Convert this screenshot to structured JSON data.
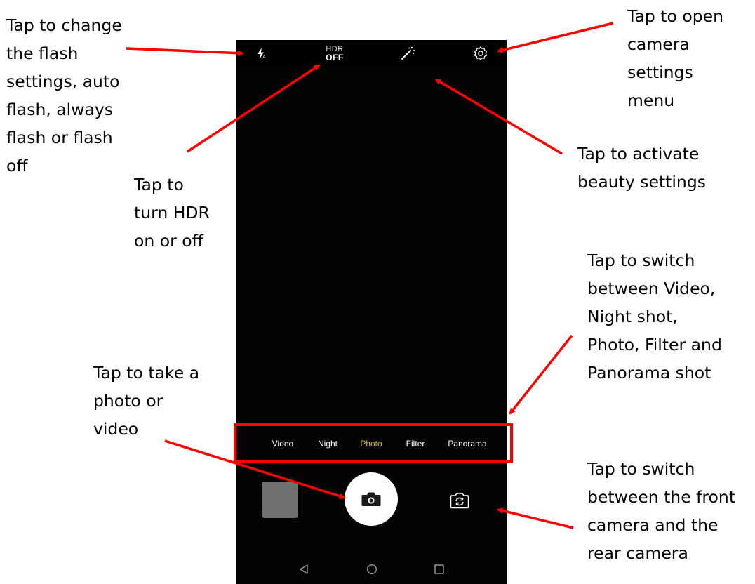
{
  "camera": {
    "hdr_line1": "HDR",
    "hdr_line2": "OFF",
    "modes": [
      {
        "label": "Video",
        "active": false
      },
      {
        "label": "Night",
        "active": false
      },
      {
        "label": "Photo",
        "active": true
      },
      {
        "label": "Filter",
        "active": false
      },
      {
        "label": "Panorama",
        "active": false
      }
    ],
    "icons": {
      "flash": "flash-icon",
      "beauty": "magic-wand-icon",
      "settings": "gear-icon",
      "shutter": "camera-icon",
      "switch": "switch-camera-icon",
      "nav_back": "triangle-back-icon",
      "nav_home": "circle-home-icon",
      "nav_recent": "square-recent-icon"
    },
    "colors": {
      "active_mode": "#e5b43b",
      "annotation": "#ff0000"
    }
  },
  "annotations": {
    "flash": [
      "Tap to change",
      "the flash",
      "settings, auto",
      "flash, always",
      "flash or flash",
      "off"
    ],
    "hdr": [
      "Tap to",
      "turn HDR",
      "on or off"
    ],
    "settings": [
      "Tap to open",
      "camera",
      "settings",
      "menu"
    ],
    "beauty": [
      "Tap to activate",
      "beauty settings"
    ],
    "modes": [
      "Tap to switch",
      "between Video,",
      "Night shot,",
      "Photo, Filter and",
      "Panorama shot"
    ],
    "shutter": [
      "Tap to take a",
      "photo or",
      "video"
    ],
    "switch": [
      "Tap to switch",
      "between the front",
      "camera and the",
      "rear camera"
    ]
  }
}
